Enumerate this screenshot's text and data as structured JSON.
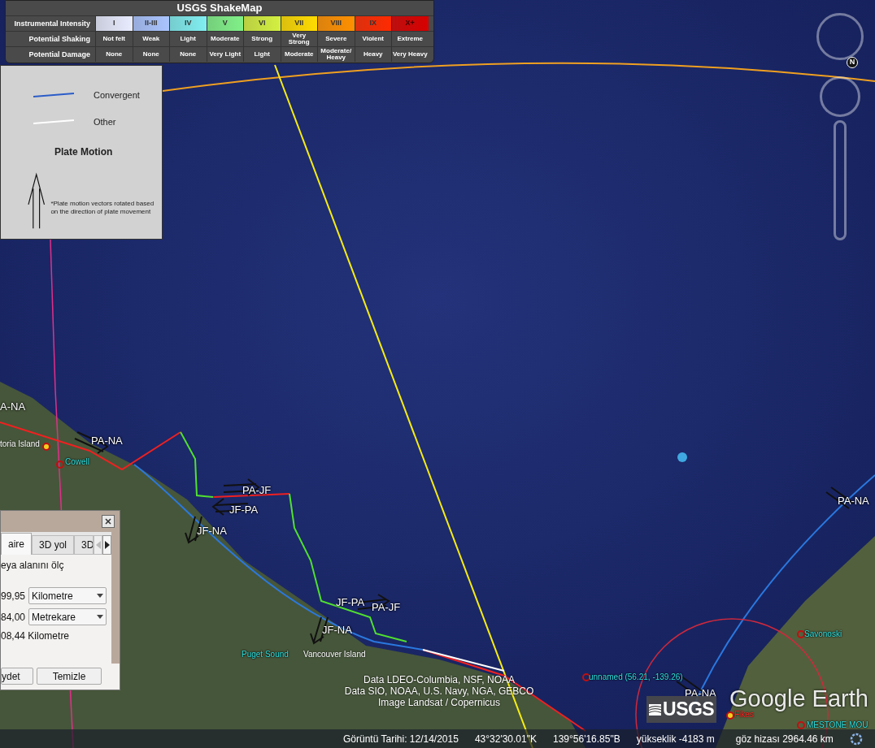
{
  "shakemap_legend": {
    "title": "USGS ShakeMap",
    "row_headers": [
      "Instrumental Intensity",
      "Potential Shaking",
      "Potential Damage"
    ],
    "levels": [
      {
        "intensity": "I",
        "shaking": "Not felt",
        "damage": "None",
        "color": "#e8ecff"
      },
      {
        "intensity": "II-III",
        "shaking": "Weak",
        "damage": "None",
        "color": "#aac4ff"
      },
      {
        "intensity": "IV",
        "shaking": "Light",
        "damage": "None",
        "color": "#80eef0"
      },
      {
        "intensity": "V",
        "shaking": "Moderate",
        "damage": "Very Light",
        "color": "#80f088"
      },
      {
        "intensity": "VI",
        "shaking": "Strong",
        "damage": "Light",
        "color": "#d4f040"
      },
      {
        "intensity": "VII",
        "shaking": "Very Strong",
        "damage": "Moderate",
        "color": "#ffdc00"
      },
      {
        "intensity": "VIII",
        "shaking": "Severe",
        "damage": "Moderate/ Heavy",
        "color": "#ff9000"
      },
      {
        "intensity": "IX",
        "shaking": "Violent",
        "damage": "Heavy",
        "color": "#ff2a00"
      },
      {
        "intensity": "X+",
        "shaking": "Extreme",
        "damage": "Very Heavy",
        "color": "#d80000"
      }
    ]
  },
  "plate_legend": {
    "items": [
      {
        "label": "Convergent",
        "color": "#2a5cc8"
      },
      {
        "label": "Other",
        "color": "#ffffff"
      }
    ],
    "heading": "Plate Motion",
    "note": "*Plate motion vectors rotated based on the direction of plate movement"
  },
  "map_labels": [
    {
      "text": "A-NA",
      "kind": "boundary"
    },
    {
      "text": "PA-NA",
      "kind": "boundary"
    },
    {
      "text": "toria Island",
      "kind": "place"
    },
    {
      "text": "Cowell",
      "kind": "town"
    },
    {
      "text": "PA-JF",
      "kind": "boundary"
    },
    {
      "text": "JF-PA",
      "kind": "boundary"
    },
    {
      "text": "JF-NA",
      "kind": "boundary"
    },
    {
      "text": "JF-PA",
      "kind": "boundary"
    },
    {
      "text": "PA-JF",
      "kind": "boundary"
    },
    {
      "text": "JF-NA",
      "kind": "boundary"
    },
    {
      "text": "Puget Sound",
      "kind": "town"
    },
    {
      "text": "Vancouver Island",
      "kind": "place"
    },
    {
      "text": "PA-NA",
      "kind": "boundary"
    },
    {
      "text": "unnamed (56.21, -139.26)",
      "kind": "town"
    },
    {
      "text": "PA-NA",
      "kind": "boundary"
    },
    {
      "text": "Savonoski",
      "kind": "town"
    },
    {
      "text": "Fikes",
      "kind": "alert"
    },
    {
      "text": "MESTONE MOU",
      "kind": "town"
    }
  ],
  "measure_dialog": {
    "tabs": [
      {
        "label": "aire",
        "selected": true
      },
      {
        "label": "3D yol",
        "selected": false
      },
      {
        "label": "3D",
        "selected": false
      }
    ],
    "description": "eya alanını ölç",
    "rows": [
      {
        "value": "99,95",
        "unit": "Kilometre"
      },
      {
        "value": "84,00",
        "unit": "Metrekare"
      }
    ],
    "perimeter": "08,44 Kilometre",
    "buttons": [
      "ydet",
      "Temizle"
    ]
  },
  "navigation": {
    "north_label": "N"
  },
  "attribution": [
    "Data LDEO-Columbia, NSF, NOAA",
    "Data SIO, NOAA, U.S. Navy, NGA, GEBCO",
    "Image Landsat / Copernicus"
  ],
  "logos": {
    "usgs": "USGS",
    "google_earth": "Google Earth"
  },
  "status_bar": {
    "imagery_date": "Görüntü Tarihi: 12/14/2015",
    "latitude": "43°32'30.01\"K",
    "longitude": "139°56'16.85\"B",
    "elevation": "yükseklik -4183 m",
    "eye_altitude": "göz hizası 2964.46 km"
  }
}
